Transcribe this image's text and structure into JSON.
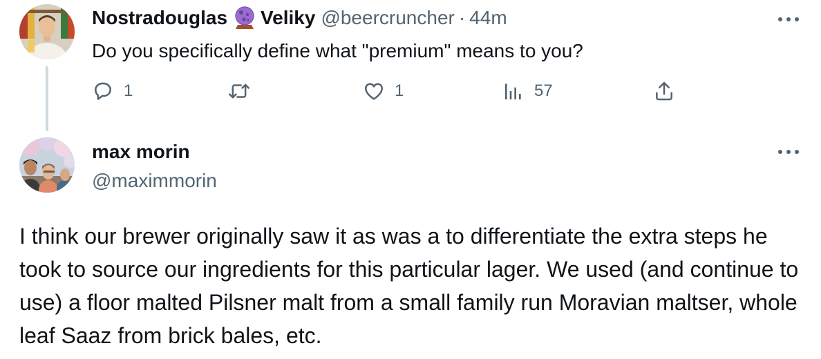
{
  "tweet1": {
    "display_name": "Nostradouglas",
    "emoji_icon": "crystal-ball-icon",
    "display_name_suffix": "Veliky",
    "handle": "@beercruncher",
    "separator": "·",
    "time": "44m",
    "text": "Do you specifically define what \"premium\" means to you?",
    "actions": {
      "reply_count": "1",
      "retweet_count": "",
      "like_count": "1",
      "views_count": "57"
    }
  },
  "tweet2": {
    "display_name": "max morin",
    "handle": "@maximmorin",
    "text": "I think our brewer originally saw it as was a to differentiate the extra steps he took to source our ingredients for this particular lager. We used (and continue to use) a floor malted Pilsner malt from a small family run Moravian maltser, whole leaf Saaz from brick bales, etc."
  },
  "colors": {
    "text_primary": "#0f1419",
    "text_secondary": "#536471",
    "thread_line": "#cfd9de",
    "background": "#ffffff"
  }
}
